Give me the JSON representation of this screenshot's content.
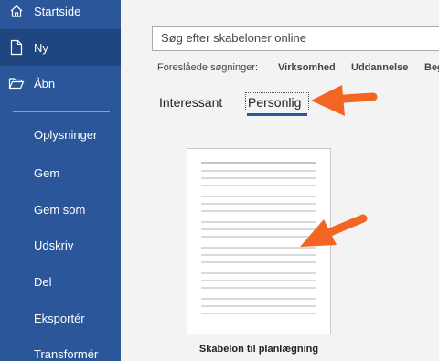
{
  "sidebar": {
    "items": [
      {
        "label": "Startside",
        "icon": "home-icon"
      },
      {
        "label": "Ny",
        "icon": "new-document-icon",
        "active": true
      },
      {
        "label": "Åbn",
        "icon": "open-folder-icon"
      }
    ],
    "subitems": [
      "Oplysninger",
      "Gem",
      "Gem som",
      "Udskriv",
      "Del",
      "Eksportér",
      "Transformér"
    ]
  },
  "search": {
    "placeholder": "Søg efter skabeloner online"
  },
  "suggestions": {
    "label": "Foreslåede søgninger:",
    "links": [
      "Virksomhed",
      "Uddannelse",
      "Beg"
    ]
  },
  "tabs": [
    {
      "label": "Interessant",
      "selected": false
    },
    {
      "label": "Personlig",
      "selected": true
    }
  ],
  "template": {
    "caption": "Skabelon til planlægning"
  },
  "colors": {
    "sidebar": "#2b579a",
    "sidebar_active": "#1f4680",
    "accent": "#2b579a",
    "annotation_arrow": "#f26522"
  }
}
